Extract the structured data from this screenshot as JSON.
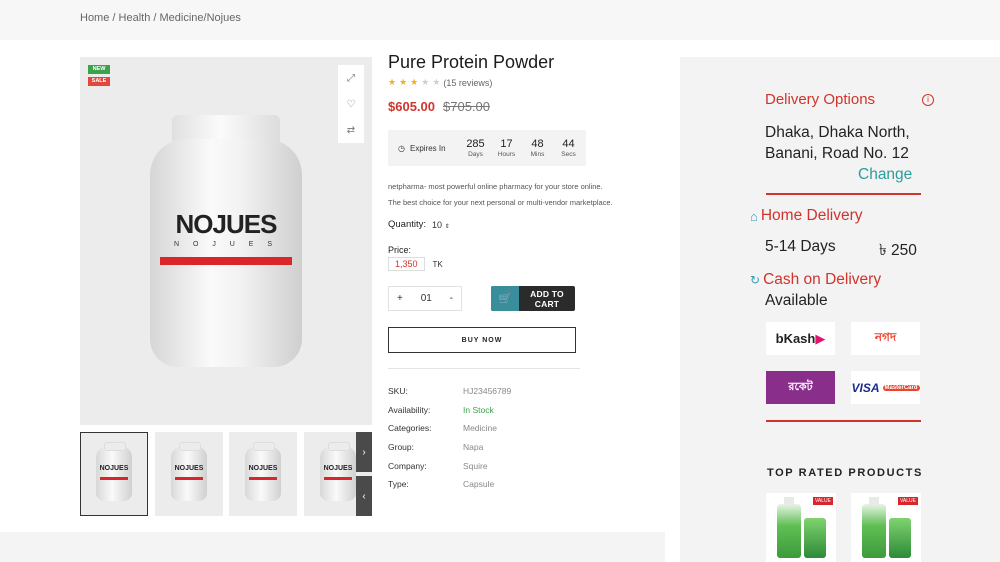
{
  "breadcrumb": {
    "home": "Home",
    "sep1": "/",
    "health": "Health",
    "sep2": "/",
    "current": "Medicine/Nojues"
  },
  "gallery": {
    "badge_new": "NEW",
    "badge_sale": "SALE",
    "brand_logo": "NOJUES",
    "brand_sub": "N O J U E S",
    "thumb_logo": "NOJUES",
    "next_arrow": "›",
    "prev_arrow": "‹"
  },
  "product": {
    "title": "Pure Protein Powder",
    "rating": 3,
    "rating_max": 5,
    "reviews": "(15 reviews)",
    "price_new": "$605.00",
    "price_old": "$705.00",
    "countdown": {
      "label": "Expires In",
      "units": [
        {
          "value": "285",
          "label": "Days"
        },
        {
          "value": "17",
          "label": "Hours"
        },
        {
          "value": "48",
          "label": "Mins"
        },
        {
          "value": "44",
          "label": "Secs"
        }
      ]
    },
    "desc_line1": "netpharma- most powerful online pharmacy for your store online.",
    "desc_line2": "The best choice for your next personal or multi-vendor marketplace.",
    "quantity_label": "Quantity:",
    "quantity_value": "10",
    "price_label": "Price:",
    "price_value": "1,350",
    "currency": "TK",
    "stepper_minus": "+",
    "stepper_value": "01",
    "stepper_plus": "-",
    "add_to_cart": "ADD TO CART",
    "buy_now": "BUY NOW",
    "meta": [
      {
        "key": "SKU:",
        "value": "HJ23456789"
      },
      {
        "key": "Availability:",
        "value": "In Stock"
      },
      {
        "key": "Categories:",
        "value": "Medicine"
      },
      {
        "key": "Group:",
        "value": "Napa"
      },
      {
        "key": "Company:",
        "value": "Squire"
      },
      {
        "key": "Type:",
        "value": "Capsule"
      }
    ]
  },
  "delivery": {
    "title": "Delivery Options",
    "address_line1": "Dhaka, Dhaka North,",
    "address_line2": "Banani, Road No. 12",
    "change": "Change",
    "home_delivery": "Home Delivery",
    "days": "5-14 Days",
    "fee": "৳ 250",
    "cod": "Cash on Delivery",
    "available": "Available",
    "payments": {
      "bkash_b": "bKash",
      "nagad": "নগদ",
      "rocket": "রকেট",
      "visa": "VISA",
      "mastercard": "MasterCard"
    }
  },
  "top_rated": {
    "title": "TOP RATED PRODUCTS",
    "tag1": "VALUE",
    "tag2": "VALUE"
  },
  "colors": {
    "accent_red": "#d0342c",
    "teal": "#2a9d9a",
    "stock_green": "#3aa44b"
  }
}
